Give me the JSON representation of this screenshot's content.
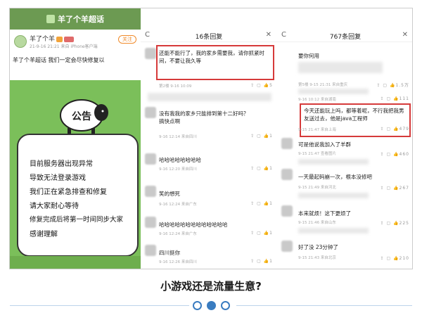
{
  "panel1": {
    "title": "羊了个羊超话",
    "user": "羊了个羊",
    "user_meta": "21-9-16 21:21 来自 iPhone客户端",
    "follow": "关注",
    "post": "羊了个羊超话 我们一定会尽快修复以",
    "notice": "公告",
    "lines": [
      "目前服务器出现异常",
      "导致无法登录游戏",
      "我们正在紧急排查和修复",
      "请大家耐心等待",
      "修复完成后将第一时间同步大家",
      "感谢理解"
    ]
  },
  "panel2": {
    "back": "C",
    "title": "16条回复",
    "close": "✕",
    "comments": [
      {
        "text": "还能不能行了，我的家乡需要我，请你抓紧时间，不要让我久等",
        "meta": "第2楼 9-16 10:09",
        "likes": "5"
      },
      {
        "text": "没有我我的家乡只能排到第十二好吗？搞快点啊",
        "meta": "9-16 12:14 来自四川",
        "likes": "1"
      },
      {
        "text": "哈哈哈哈哈哈哈哈",
        "meta": "9-16 12:20 来自四川",
        "likes": "1"
      },
      {
        "text": "笑的想死",
        "meta": "9-16 12:24 来自广东",
        "likes": "1"
      },
      {
        "text": "哈哈哈哈哈哈哈哈哈哈哈哈哈",
        "meta": "9-16 12:24 来自广东",
        "likes": "1"
      },
      {
        "text": "四川挺你",
        "meta": "9-16 12:26 来自四川",
        "likes": "1"
      }
    ]
  },
  "panel3": {
    "back": "C",
    "title": "767条回复",
    "close": "✕",
    "comments": [
      {
        "text": "要你何用",
        "meta": "",
        "likes": ""
      },
      {
        "text": "",
        "meta": "第5楼 9-15 21:31 来自重庆",
        "likes": "1.5万"
      },
      {
        "text": "",
        "meta": "9-16 10:12 来自湖南",
        "likes": "111"
      },
      {
        "text": "今天还能玩上吗，都等着呢，不行我把我男友送过去，他是java工程师",
        "meta": "9-15 21:47 来自上海",
        "likes": "479"
      },
      {
        "text": "可是他说我加入了羊群",
        "meta": "9-15 21:47 查看图片",
        "likes": "460"
      },
      {
        "text": "一天最起码崩一次，根本没修吧",
        "meta": "9-15 21:49 来自河北",
        "likes": "267"
      },
      {
        "text": "本来就烦！这下更烦了",
        "meta": "9-15 21:46 来自山东",
        "likes": "225"
      },
      {
        "text": "好了没 23分钟了",
        "meta": "9-15 21:43 来自北京",
        "likes": "210"
      }
    ]
  },
  "caption": "小游戏还是流量生意?",
  "colors": {
    "accent": "#3a7cc0",
    "highlight": "#d63a3a",
    "green": "#7bbf5a"
  }
}
